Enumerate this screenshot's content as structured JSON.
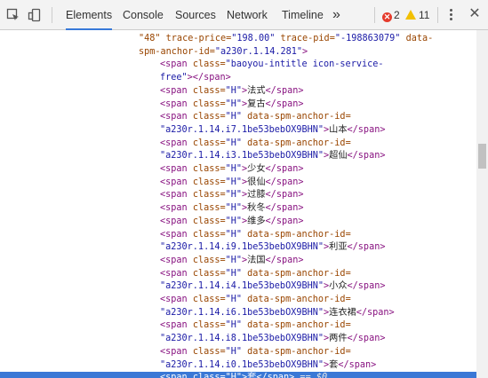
{
  "toolbar": {
    "tabs": [
      {
        "label": "Elements",
        "active": true
      },
      {
        "label": "Console",
        "active": false
      },
      {
        "label": "Sources",
        "active": false
      },
      {
        "label": "Network",
        "active": false
      },
      {
        "label": "Timeline",
        "active": false
      }
    ],
    "more_label": "»",
    "error_count": "2",
    "warning_count": "11",
    "icons": {
      "inspect": "inspect-element-icon",
      "device": "device-mode-icon",
      "menu": "kebab-menu-icon",
      "close": "close-icon"
    },
    "colors": {
      "accent": "#3879d9",
      "error": "#e53b2c",
      "warning": "#f2c000"
    }
  },
  "code": {
    "lines": [
      {
        "segments": [
          {
            "c": "an",
            "t": "\"48\" trace-price="
          },
          {
            "c": "av",
            "t": "\"198.00\""
          },
          {
            "c": "an",
            "t": " trace-pid="
          },
          {
            "c": "av",
            "t": "\"-198863079\""
          },
          {
            "c": "an",
            "t": " data-"
          }
        ]
      },
      {
        "segments": [
          {
            "c": "an",
            "t": "spm-anchor-id="
          },
          {
            "c": "av",
            "t": "\"a230r.1.14.281\""
          },
          {
            "c": "tg",
            "t": ">"
          }
        ]
      },
      {
        "segments": [
          {
            "c": "tg",
            "t": "<span "
          },
          {
            "c": "an",
            "t": "class="
          },
          {
            "c": "av",
            "t": "\"baoyou-intitle icon-service-"
          }
        ]
      },
      {
        "segments": [
          {
            "c": "av",
            "t": "free\""
          },
          {
            "c": "tg",
            "t": "></span>"
          }
        ]
      },
      {
        "segments": [
          {
            "c": "tg",
            "t": "<span "
          },
          {
            "c": "an",
            "t": "class="
          },
          {
            "c": "av",
            "t": "\"H\""
          },
          {
            "c": "tg",
            "t": ">"
          },
          {
            "c": "tx",
            "t": "法式"
          },
          {
            "c": "tg",
            "t": "</span>"
          }
        ]
      },
      {
        "segments": [
          {
            "c": "tg",
            "t": "<span "
          },
          {
            "c": "an",
            "t": "class="
          },
          {
            "c": "av",
            "t": "\"H\""
          },
          {
            "c": "tg",
            "t": ">"
          },
          {
            "c": "tx",
            "t": "复古"
          },
          {
            "c": "tg",
            "t": "</span>"
          }
        ]
      },
      {
        "segments": [
          {
            "c": "tg",
            "t": "<span "
          },
          {
            "c": "an",
            "t": "class="
          },
          {
            "c": "av",
            "t": "\"H\""
          },
          {
            "c": "an",
            "t": " data-spm-anchor-id="
          }
        ]
      },
      {
        "segments": [
          {
            "c": "av",
            "t": "\"a230r.1.14.i7.1be53bebOX9BHN\""
          },
          {
            "c": "tg",
            "t": ">"
          },
          {
            "c": "tx",
            "t": "山本"
          },
          {
            "c": "tg",
            "t": "</span>"
          }
        ]
      },
      {
        "segments": [
          {
            "c": "tg",
            "t": "<span "
          },
          {
            "c": "an",
            "t": "class="
          },
          {
            "c": "av",
            "t": "\"H\""
          },
          {
            "c": "an",
            "t": " data-spm-anchor-id="
          }
        ]
      },
      {
        "segments": [
          {
            "c": "av",
            "t": "\"a230r.1.14.i3.1be53bebOX9BHN\""
          },
          {
            "c": "tg",
            "t": ">"
          },
          {
            "c": "tx",
            "t": "超仙"
          },
          {
            "c": "tg",
            "t": "</span>"
          }
        ]
      },
      {
        "segments": [
          {
            "c": "tg",
            "t": "<span "
          },
          {
            "c": "an",
            "t": "class="
          },
          {
            "c": "av",
            "t": "\"H\""
          },
          {
            "c": "tg",
            "t": ">"
          },
          {
            "c": "tx",
            "t": "少女"
          },
          {
            "c": "tg",
            "t": "</span>"
          }
        ]
      },
      {
        "segments": [
          {
            "c": "tg",
            "t": "<span "
          },
          {
            "c": "an",
            "t": "class="
          },
          {
            "c": "av",
            "t": "\"H\""
          },
          {
            "c": "tg",
            "t": ">"
          },
          {
            "c": "tx",
            "t": "很仙"
          },
          {
            "c": "tg",
            "t": "</span>"
          }
        ]
      },
      {
        "segments": [
          {
            "c": "tg",
            "t": "<span "
          },
          {
            "c": "an",
            "t": "class="
          },
          {
            "c": "av",
            "t": "\"H\""
          },
          {
            "c": "tg",
            "t": ">"
          },
          {
            "c": "tx",
            "t": "过膝"
          },
          {
            "c": "tg",
            "t": "</span>"
          }
        ]
      },
      {
        "segments": [
          {
            "c": "tg",
            "t": "<span "
          },
          {
            "c": "an",
            "t": "class="
          },
          {
            "c": "av",
            "t": "\"H\""
          },
          {
            "c": "tg",
            "t": ">"
          },
          {
            "c": "tx",
            "t": "秋冬"
          },
          {
            "c": "tg",
            "t": "</span>"
          }
        ]
      },
      {
        "segments": [
          {
            "c": "tg",
            "t": "<span "
          },
          {
            "c": "an",
            "t": "class="
          },
          {
            "c": "av",
            "t": "\"H\""
          },
          {
            "c": "tg",
            "t": ">"
          },
          {
            "c": "tx",
            "t": "维多"
          },
          {
            "c": "tg",
            "t": "</span>"
          }
        ]
      },
      {
        "segments": [
          {
            "c": "tg",
            "t": "<span "
          },
          {
            "c": "an",
            "t": "class="
          },
          {
            "c": "av",
            "t": "\"H\""
          },
          {
            "c": "an",
            "t": " data-spm-anchor-id="
          }
        ]
      },
      {
        "segments": [
          {
            "c": "av",
            "t": "\"a230r.1.14.i9.1be53bebOX9BHN\""
          },
          {
            "c": "tg",
            "t": ">"
          },
          {
            "c": "tx",
            "t": "利亚"
          },
          {
            "c": "tg",
            "t": "</span>"
          }
        ]
      },
      {
        "segments": [
          {
            "c": "tg",
            "t": "<span "
          },
          {
            "c": "an",
            "t": "class="
          },
          {
            "c": "av",
            "t": "\"H\""
          },
          {
            "c": "tg",
            "t": ">"
          },
          {
            "c": "tx",
            "t": "法国"
          },
          {
            "c": "tg",
            "t": "</span>"
          }
        ]
      },
      {
        "segments": [
          {
            "c": "tg",
            "t": "<span "
          },
          {
            "c": "an",
            "t": "class="
          },
          {
            "c": "av",
            "t": "\"H\""
          },
          {
            "c": "an",
            "t": " data-spm-anchor-id="
          }
        ]
      },
      {
        "segments": [
          {
            "c": "av",
            "t": "\"a230r.1.14.i4.1be53bebOX9BHN\""
          },
          {
            "c": "tg",
            "t": ">"
          },
          {
            "c": "tx",
            "t": "小众"
          },
          {
            "c": "tg",
            "t": "</span>"
          }
        ]
      },
      {
        "segments": [
          {
            "c": "tg",
            "t": "<span "
          },
          {
            "c": "an",
            "t": "class="
          },
          {
            "c": "av",
            "t": "\"H\""
          },
          {
            "c": "an",
            "t": " data-spm-anchor-id="
          }
        ]
      },
      {
        "segments": [
          {
            "c": "av",
            "t": "\"a230r.1.14.i6.1be53bebOX9BHN\""
          },
          {
            "c": "tg",
            "t": ">"
          },
          {
            "c": "tx",
            "t": "连衣裙"
          },
          {
            "c": "tg",
            "t": "</span>"
          }
        ]
      },
      {
        "segments": [
          {
            "c": "tg",
            "t": "<span "
          },
          {
            "c": "an",
            "t": "class="
          },
          {
            "c": "av",
            "t": "\"H\""
          },
          {
            "c": "an",
            "t": " data-spm-anchor-id="
          }
        ]
      },
      {
        "segments": [
          {
            "c": "av",
            "t": "\"a230r.1.14.i8.1be53bebOX9BHN\""
          },
          {
            "c": "tg",
            "t": ">"
          },
          {
            "c": "tx",
            "t": "两件"
          },
          {
            "c": "tg",
            "t": "</span>"
          }
        ]
      },
      {
        "segments": [
          {
            "c": "tg",
            "t": "<span "
          },
          {
            "c": "an",
            "t": "class="
          },
          {
            "c": "av",
            "t": "\"H\""
          },
          {
            "c": "an",
            "t": " data-spm-anchor-id="
          }
        ]
      },
      {
        "segments": [
          {
            "c": "av",
            "t": "\"a230r.1.14.i0.1be53bebOX9BHN\""
          },
          {
            "c": "tg",
            "t": ">"
          },
          {
            "c": "tx",
            "t": "套"
          },
          {
            "c": "tg",
            "t": "</span>"
          }
        ]
      },
      {
        "segments": [
          {
            "c": "tg",
            "t": "<span "
          },
          {
            "c": "an",
            "t": "class="
          },
          {
            "c": "av",
            "t": "\"H\""
          },
          {
            "c": "tg",
            "t": ">"
          },
          {
            "c": "tx",
            "t": "套"
          },
          {
            "c": "tg",
            "t": "</span>"
          }
        ],
        "selected": true,
        "suffix": " == $0",
        "gutter": "..."
      }
    ]
  }
}
